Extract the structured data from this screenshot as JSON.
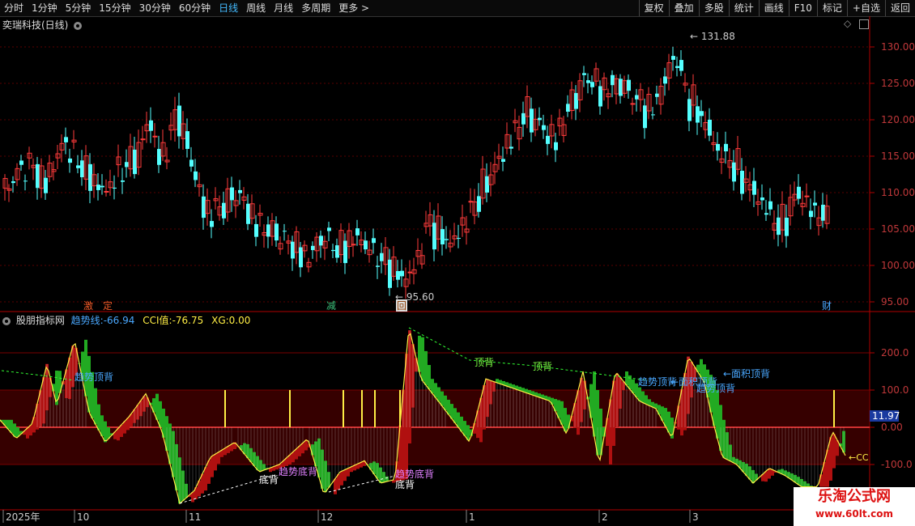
{
  "toolbar": {
    "periods": [
      "分时",
      "1分钟",
      "5分钟",
      "15分钟",
      "30分钟",
      "60分钟",
      "日线",
      "周线",
      "月线",
      "多周期",
      "更多 >"
    ],
    "active_period": "日线",
    "actions": [
      "复权",
      "叠加",
      "多股",
      "统计",
      "画线",
      "F10",
      "标记",
      "+自选",
      "返回"
    ]
  },
  "main_panel": {
    "title": "奕瑞科技(日线)",
    "high_label": "131.88",
    "low_label": "95.60",
    "price_ticks": [
      "130.00",
      "125.00",
      "120.00",
      "115.00",
      "110.00",
      "105.00",
      "100.00",
      "95.00"
    ],
    "markers": [
      {
        "text": "激",
        "color": "#f05a28"
      },
      {
        "text": "定",
        "color": "#f05a28"
      },
      {
        "text": "减",
        "color": "#3cc07a"
      },
      {
        "text": "回",
        "color": "#f0a050"
      },
      {
        "text": "财",
        "color": "#4aa8ff"
      }
    ]
  },
  "indicator_panel": {
    "name": "股朋指标网",
    "trend_label": "趋势线:",
    "trend_value": "-66.94",
    "cci_label": "CCI值:",
    "cci_value": "-76.75",
    "xg_label": "XG:",
    "xg_value": "0.00",
    "ticks": [
      "200.0",
      "100.0",
      "0.00",
      "-100.0"
    ],
    "current_value": "11.97",
    "right_tag": "←CC",
    "annotations": [
      "趋势顶背",
      "顶背",
      "顶背",
      "趋势顶背",
      "←面积顶背",
      "←面积顶背",
      "趋势顶背",
      "趋势底背",
      "底背",
      "趋势底背",
      "底背"
    ]
  },
  "time_axis": {
    "labels": [
      "2025年",
      "10",
      "11",
      "12",
      "1",
      "2",
      "3"
    ]
  },
  "watermark": {
    "line1": "乐淘公式网",
    "line2": "www.60lt.com"
  },
  "colors": {
    "up": "#ff3b3b",
    "down": "#54ffff",
    "trend_up": "#8b0000",
    "trend_down": "#22aa22",
    "band": "#5a0000",
    "axis": "#b00000"
  }
}
